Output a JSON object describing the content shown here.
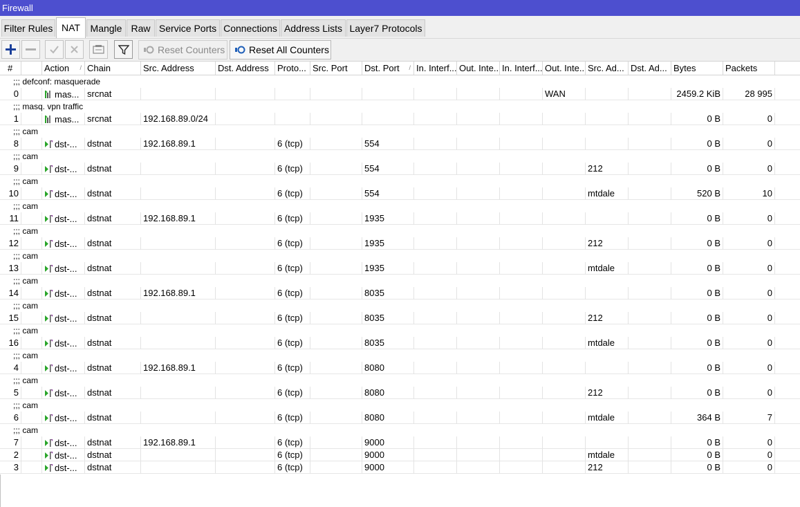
{
  "window": {
    "title": "Firewall"
  },
  "tabs": [
    {
      "label": "Filter Rules"
    },
    {
      "label": "NAT"
    },
    {
      "label": "Mangle"
    },
    {
      "label": "Raw"
    },
    {
      "label": "Service Ports"
    },
    {
      "label": "Connections"
    },
    {
      "label": "Address Lists"
    },
    {
      "label": "Layer7 Protocols"
    }
  ],
  "active_tab": "NAT",
  "toolbar": {
    "reset_counters": "Reset Counters",
    "reset_all_counters": "Reset All Counters",
    "icons": [
      "add-icon",
      "remove-icon",
      "enable-icon",
      "disable-icon",
      "comment-icon",
      "filter-icon"
    ]
  },
  "table": {
    "columns": [
      {
        "label": "#"
      },
      {
        "label": ""
      },
      {
        "label": "Action"
      },
      {
        "label": "Chain"
      },
      {
        "label": "Src. Address"
      },
      {
        "label": "Dst. Address"
      },
      {
        "label": "Proto..."
      },
      {
        "label": "Src. Port"
      },
      {
        "label": "Dst. Port"
      },
      {
        "label": "In. Interf..."
      },
      {
        "label": "Out. Inte..."
      },
      {
        "label": "In. Interf..."
      },
      {
        "label": "Out. Inte..."
      },
      {
        "label": "Src. Ad..."
      },
      {
        "label": "Dst. Ad..."
      },
      {
        "label": "Bytes"
      },
      {
        "label": "Packets"
      }
    ],
    "rows": [
      {
        "comment": ";;; defconf: masquerade"
      },
      {
        "num": "0",
        "action": "mas...",
        "chain": "srcnat",
        "src": "",
        "proto": "",
        "dstport": "",
        "outif": "WAN",
        "srcad": "",
        "bytes": "2459.2 KiB",
        "packets": "28 995"
      },
      {
        "comment": ";;; masq. vpn traffic"
      },
      {
        "num": "1",
        "action": "mas...",
        "chain": "srcnat",
        "src": "192.168.89.0/24",
        "proto": "",
        "dstport": "",
        "outif": "",
        "srcad": "",
        "bytes": "0 B",
        "packets": "0"
      },
      {
        "comment": ";;; cam"
      },
      {
        "num": "8",
        "action": "dst-...",
        "chain": "dstnat",
        "src": "192.168.89.1",
        "proto": "6 (tcp)",
        "dstport": "554",
        "outif": "",
        "srcad": "",
        "bytes": "0 B",
        "packets": "0"
      },
      {
        "comment": ";;; cam"
      },
      {
        "num": "9",
        "action": "dst-...",
        "chain": "dstnat",
        "src": "",
        "proto": "6 (tcp)",
        "dstport": "554",
        "outif": "",
        "srcad": "212",
        "bytes": "0 B",
        "packets": "0"
      },
      {
        "comment": ";;; cam"
      },
      {
        "num": "10",
        "action": "dst-...",
        "chain": "dstnat",
        "src": "",
        "proto": "6 (tcp)",
        "dstport": "554",
        "outif": "",
        "srcad": "mtdale",
        "bytes": "520 B",
        "packets": "10"
      },
      {
        "comment": ";;; cam"
      },
      {
        "num": "11",
        "action": "dst-...",
        "chain": "dstnat",
        "src": "192.168.89.1",
        "proto": "6 (tcp)",
        "dstport": "1935",
        "outif": "",
        "srcad": "",
        "bytes": "0 B",
        "packets": "0"
      },
      {
        "comment": ";;; cam"
      },
      {
        "num": "12",
        "action": "dst-...",
        "chain": "dstnat",
        "src": "",
        "proto": "6 (tcp)",
        "dstport": "1935",
        "outif": "",
        "srcad": "212",
        "bytes": "0 B",
        "packets": "0"
      },
      {
        "comment": ";;; cam"
      },
      {
        "num": "13",
        "action": "dst-...",
        "chain": "dstnat",
        "src": "",
        "proto": "6 (tcp)",
        "dstport": "1935",
        "outif": "",
        "srcad": "mtdale",
        "bytes": "0 B",
        "packets": "0"
      },
      {
        "comment": ";;; cam"
      },
      {
        "num": "14",
        "action": "dst-...",
        "chain": "dstnat",
        "src": "192.168.89.1",
        "proto": "6 (tcp)",
        "dstport": "8035",
        "outif": "",
        "srcad": "",
        "bytes": "0 B",
        "packets": "0"
      },
      {
        "comment": ";;; cam"
      },
      {
        "num": "15",
        "action": "dst-...",
        "chain": "dstnat",
        "src": "",
        "proto": "6 (tcp)",
        "dstport": "8035",
        "outif": "",
        "srcad": "212",
        "bytes": "0 B",
        "packets": "0"
      },
      {
        "comment": ";;; cam"
      },
      {
        "num": "16",
        "action": "dst-...",
        "chain": "dstnat",
        "src": "",
        "proto": "6 (tcp)",
        "dstport": "8035",
        "outif": "",
        "srcad": "mtdale",
        "bytes": "0 B",
        "packets": "0"
      },
      {
        "comment": ";;; cam"
      },
      {
        "num": "4",
        "action": "dst-...",
        "chain": "dstnat",
        "src": "192.168.89.1",
        "proto": "6 (tcp)",
        "dstport": "8080",
        "outif": "",
        "srcad": "",
        "bytes": "0 B",
        "packets": "0"
      },
      {
        "comment": ";;; cam"
      },
      {
        "num": "5",
        "action": "dst-...",
        "chain": "dstnat",
        "src": "",
        "proto": "6 (tcp)",
        "dstport": "8080",
        "outif": "",
        "srcad": "212",
        "bytes": "0 B",
        "packets": "0"
      },
      {
        "comment": ";;; cam"
      },
      {
        "num": "6",
        "action": "dst-...",
        "chain": "dstnat",
        "src": "",
        "proto": "6 (tcp)",
        "dstport": "8080",
        "outif": "",
        "srcad": "mtdale",
        "bytes": "364 B",
        "packets": "7"
      },
      {
        "comment": ";;; cam"
      },
      {
        "num": "7",
        "action": "dst-...",
        "chain": "dstnat",
        "src": "192.168.89.1",
        "proto": "6 (tcp)",
        "dstport": "9000",
        "outif": "",
        "srcad": "",
        "bytes": "0 B",
        "packets": "0"
      },
      {
        "num": "2",
        "action": "dst-...",
        "chain": "dstnat",
        "src": "",
        "proto": "6 (tcp)",
        "dstport": "9000",
        "outif": "",
        "srcad": "mtdale",
        "bytes": "0 B",
        "packets": "0"
      },
      {
        "num": "3",
        "action": "dst-...",
        "chain": "dstnat",
        "src": "",
        "proto": "6 (tcp)",
        "dstport": "9000",
        "outif": "",
        "srcad": "212",
        "bytes": "0 B",
        "packets": "0"
      }
    ]
  },
  "colors": {
    "titlebar": "#4d4fcf",
    "add_icon": "#1a3f9a",
    "action_green": "#2aa52a",
    "action_purple": "#7a2d8a"
  }
}
